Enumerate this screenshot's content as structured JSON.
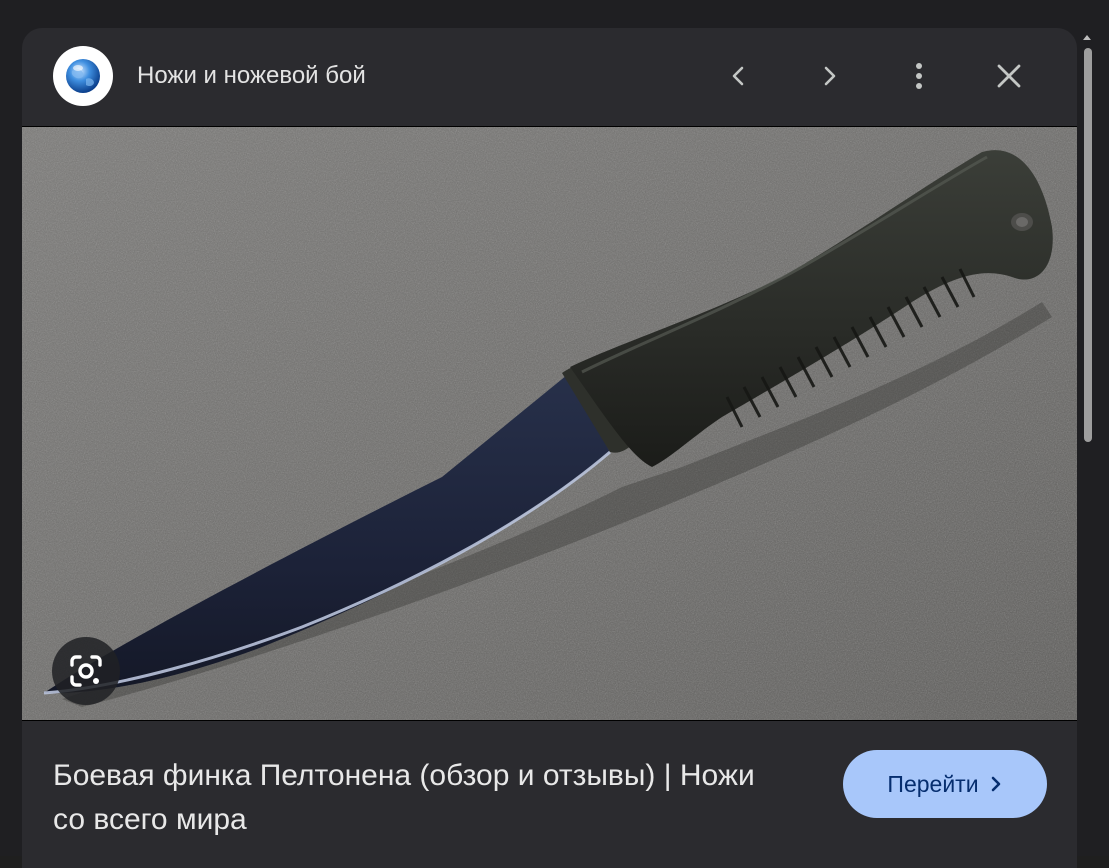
{
  "header": {
    "site_name": "Ножи и ножевой бой",
    "favicon_icon": "globe-icon",
    "prev_icon": "chevron-left-icon",
    "next_icon": "chevron-right-icon",
    "more_icon": "more-vert-icon",
    "close_icon": "close-icon"
  },
  "image": {
    "lens_icon": "google-lens-icon"
  },
  "result": {
    "title": "Боевая финка Пелтонена (обзор и отзывы) | Ножи со всего мира",
    "visit_label": "Перейти",
    "visit_icon": "chevron-right-icon"
  },
  "colors": {
    "panel_bg": "#2b2b2f",
    "accent": "#a8c7fa",
    "accent_text": "#062e6f",
    "text": "#e3e3e3"
  }
}
